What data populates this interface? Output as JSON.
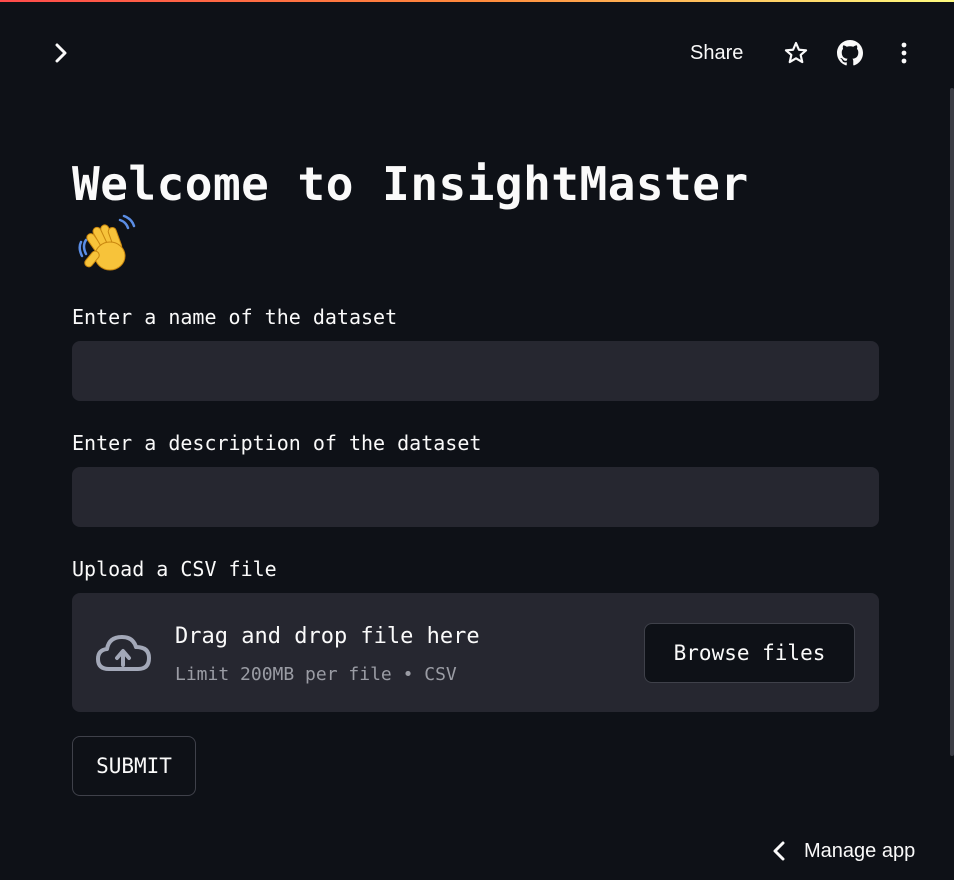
{
  "header": {
    "share_label": "Share",
    "icons": [
      "chevron-right-icon",
      "star-icon",
      "github-icon",
      "kebab-menu-icon"
    ]
  },
  "main": {
    "title": "Welcome to InsightMaster",
    "emoji": "waving-hand",
    "name_field": {
      "label": "Enter a name of the dataset",
      "value": "",
      "placeholder": ""
    },
    "description_field": {
      "label": "Enter a description of the dataset",
      "value": "",
      "placeholder": ""
    },
    "upload": {
      "label": "Upload a CSV file",
      "drop_title": "Drag and drop file here",
      "drop_subtitle": "Limit 200MB per file • CSV",
      "browse_label": "Browse files"
    },
    "submit_label": "SUBMIT"
  },
  "footer": {
    "manage_label": "Manage app"
  },
  "colors": {
    "background": "#0e1117",
    "input_bg": "#262730",
    "text": "#fafafa",
    "muted": "#9a9ca4",
    "accent_gradient": [
      "#ff4b4b",
      "#fffd80"
    ]
  }
}
